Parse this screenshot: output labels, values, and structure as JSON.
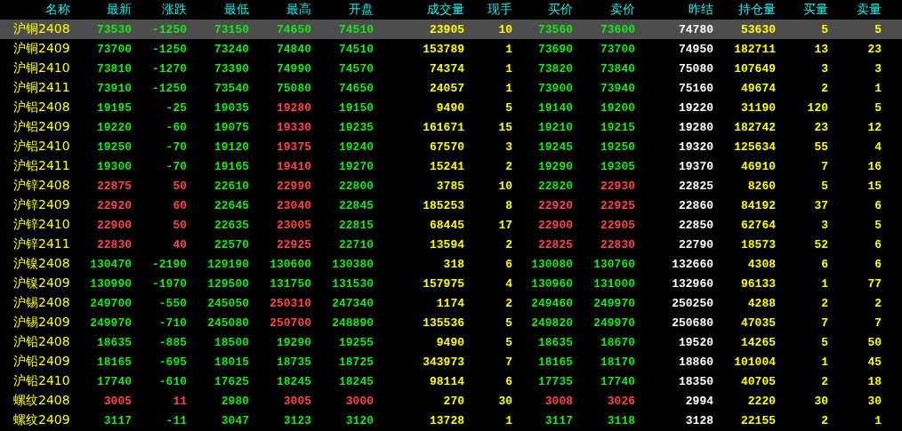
{
  "table": {
    "columns": [
      {
        "label": "名称",
        "kind": "name"
      },
      {
        "label": "最新",
        "kind": "price"
      },
      {
        "label": "涨跌",
        "kind": "price"
      },
      {
        "label": "最低",
        "kind": "price"
      },
      {
        "label": "最高",
        "kind": "price"
      },
      {
        "label": "开盘",
        "kind": "price"
      },
      {
        "label": "成交量",
        "kind": "volume"
      },
      {
        "label": "现手",
        "kind": "volume"
      },
      {
        "label": "买价",
        "kind": "price"
      },
      {
        "label": "卖价",
        "kind": "price"
      },
      {
        "label": "昨结",
        "kind": "settle"
      },
      {
        "label": "持仓量",
        "kind": "volume"
      },
      {
        "label": "买量",
        "kind": "volume"
      },
      {
        "label": "卖量",
        "kind": "volume"
      }
    ],
    "rows": [
      {
        "selected": true,
        "cells": [
          {
            "text": "沪铜2408"
          },
          {
            "text": "73530",
            "color": "#19e619"
          },
          {
            "text": "-1250",
            "color": "#19e619"
          },
          {
            "text": "73150",
            "color": "#19e619"
          },
          {
            "text": "74650",
            "color": "#19e619"
          },
          {
            "text": "74510",
            "color": "#19e619"
          },
          {
            "text": "23905"
          },
          {
            "text": "10"
          },
          {
            "text": "73560",
            "color": "#19e619"
          },
          {
            "text": "73600",
            "color": "#19e619"
          },
          {
            "text": "74780"
          },
          {
            "text": "53630"
          },
          {
            "text": "5"
          },
          {
            "text": "5"
          }
        ]
      },
      {
        "selected": false,
        "cells": [
          {
            "text": "沪铜2409"
          },
          {
            "text": "73700",
            "color": "#19e619"
          },
          {
            "text": "-1250",
            "color": "#19e619"
          },
          {
            "text": "73240",
            "color": "#19e619"
          },
          {
            "text": "74840",
            "color": "#19e619"
          },
          {
            "text": "74510",
            "color": "#19e619"
          },
          {
            "text": "153789"
          },
          {
            "text": "1"
          },
          {
            "text": "73690",
            "color": "#19e619"
          },
          {
            "text": "73700",
            "color": "#19e619"
          },
          {
            "text": "74950"
          },
          {
            "text": "182711"
          },
          {
            "text": "13"
          },
          {
            "text": "23"
          }
        ]
      },
      {
        "selected": false,
        "cells": [
          {
            "text": "沪铜2410"
          },
          {
            "text": "73810",
            "color": "#19e619"
          },
          {
            "text": "-1270",
            "color": "#19e619"
          },
          {
            "text": "73390",
            "color": "#19e619"
          },
          {
            "text": "74990",
            "color": "#19e619"
          },
          {
            "text": "74570",
            "color": "#19e619"
          },
          {
            "text": "74374"
          },
          {
            "text": "1"
          },
          {
            "text": "73820",
            "color": "#19e619"
          },
          {
            "text": "73840",
            "color": "#19e619"
          },
          {
            "text": "75080"
          },
          {
            "text": "107649"
          },
          {
            "text": "3"
          },
          {
            "text": "3"
          }
        ]
      },
      {
        "selected": false,
        "cells": [
          {
            "text": "沪铜2411"
          },
          {
            "text": "73910",
            "color": "#19e619"
          },
          {
            "text": "-1250",
            "color": "#19e619"
          },
          {
            "text": "73540",
            "color": "#19e619"
          },
          {
            "text": "75080",
            "color": "#19e619"
          },
          {
            "text": "74650",
            "color": "#19e619"
          },
          {
            "text": "24057"
          },
          {
            "text": "1"
          },
          {
            "text": "73900",
            "color": "#19e619"
          },
          {
            "text": "73940",
            "color": "#19e619"
          },
          {
            "text": "75160"
          },
          {
            "text": "49674"
          },
          {
            "text": "2"
          },
          {
            "text": "1"
          }
        ]
      },
      {
        "selected": false,
        "cells": [
          {
            "text": "沪铝2408"
          },
          {
            "text": "19195",
            "color": "#19e619"
          },
          {
            "text": "-25",
            "color": "#19e619"
          },
          {
            "text": "19035",
            "color": "#19e619"
          },
          {
            "text": "19280",
            "color": "#ff4646"
          },
          {
            "text": "19150",
            "color": "#19e619"
          },
          {
            "text": "9490"
          },
          {
            "text": "5"
          },
          {
            "text": "19140",
            "color": "#19e619"
          },
          {
            "text": "19200",
            "color": "#19e619"
          },
          {
            "text": "19220"
          },
          {
            "text": "31190"
          },
          {
            "text": "120"
          },
          {
            "text": "5"
          }
        ]
      },
      {
        "selected": false,
        "cells": [
          {
            "text": "沪铝2409"
          },
          {
            "text": "19220",
            "color": "#19e619"
          },
          {
            "text": "-60",
            "color": "#19e619"
          },
          {
            "text": "19075",
            "color": "#19e619"
          },
          {
            "text": "19330",
            "color": "#ff4646"
          },
          {
            "text": "19235",
            "color": "#19e619"
          },
          {
            "text": "161671"
          },
          {
            "text": "15"
          },
          {
            "text": "19210",
            "color": "#19e619"
          },
          {
            "text": "19215",
            "color": "#19e619"
          },
          {
            "text": "19280"
          },
          {
            "text": "182742"
          },
          {
            "text": "23"
          },
          {
            "text": "12"
          }
        ]
      },
      {
        "selected": false,
        "cells": [
          {
            "text": "沪铝2410"
          },
          {
            "text": "19250",
            "color": "#19e619"
          },
          {
            "text": "-70",
            "color": "#19e619"
          },
          {
            "text": "19120",
            "color": "#19e619"
          },
          {
            "text": "19375",
            "color": "#ff4646"
          },
          {
            "text": "19240",
            "color": "#19e619"
          },
          {
            "text": "67570"
          },
          {
            "text": "3"
          },
          {
            "text": "19245",
            "color": "#19e619"
          },
          {
            "text": "19250",
            "color": "#19e619"
          },
          {
            "text": "19320"
          },
          {
            "text": "125634"
          },
          {
            "text": "55"
          },
          {
            "text": "4"
          }
        ]
      },
      {
        "selected": false,
        "cells": [
          {
            "text": "沪铝2411"
          },
          {
            "text": "19300",
            "color": "#19e619"
          },
          {
            "text": "-70",
            "color": "#19e619"
          },
          {
            "text": "19165",
            "color": "#19e619"
          },
          {
            "text": "19410",
            "color": "#ff4646"
          },
          {
            "text": "19270",
            "color": "#19e619"
          },
          {
            "text": "15241"
          },
          {
            "text": "2"
          },
          {
            "text": "19290",
            "color": "#19e619"
          },
          {
            "text": "19305",
            "color": "#19e619"
          },
          {
            "text": "19370"
          },
          {
            "text": "46910"
          },
          {
            "text": "7"
          },
          {
            "text": "16"
          }
        ]
      },
      {
        "selected": false,
        "cells": [
          {
            "text": "沪锌2408"
          },
          {
            "text": "22875",
            "color": "#ff4646"
          },
          {
            "text": "50",
            "color": "#ff4646"
          },
          {
            "text": "22610",
            "color": "#19e619"
          },
          {
            "text": "22990",
            "color": "#ff4646"
          },
          {
            "text": "22800",
            "color": "#19e619"
          },
          {
            "text": "3785"
          },
          {
            "text": "10"
          },
          {
            "text": "22820",
            "color": "#19e619"
          },
          {
            "text": "22930",
            "color": "#ff4646"
          },
          {
            "text": "22825"
          },
          {
            "text": "8260"
          },
          {
            "text": "5"
          },
          {
            "text": "15"
          }
        ]
      },
      {
        "selected": false,
        "cells": [
          {
            "text": "沪锌2409"
          },
          {
            "text": "22920",
            "color": "#ff4646"
          },
          {
            "text": "60",
            "color": "#ff4646"
          },
          {
            "text": "22645",
            "color": "#19e619"
          },
          {
            "text": "23040",
            "color": "#ff4646"
          },
          {
            "text": "22845",
            "color": "#19e619"
          },
          {
            "text": "185253"
          },
          {
            "text": "8"
          },
          {
            "text": "22920",
            "color": "#ff4646"
          },
          {
            "text": "22925",
            "color": "#ff4646"
          },
          {
            "text": "22860"
          },
          {
            "text": "84192"
          },
          {
            "text": "37"
          },
          {
            "text": "6"
          }
        ]
      },
      {
        "selected": false,
        "cells": [
          {
            "text": "沪锌2410"
          },
          {
            "text": "22900",
            "color": "#ff4646"
          },
          {
            "text": "50",
            "color": "#ff4646"
          },
          {
            "text": "22635",
            "color": "#19e619"
          },
          {
            "text": "23005",
            "color": "#ff4646"
          },
          {
            "text": "22815",
            "color": "#19e619"
          },
          {
            "text": "68445"
          },
          {
            "text": "17"
          },
          {
            "text": "22900",
            "color": "#ff4646"
          },
          {
            "text": "22905",
            "color": "#ff4646"
          },
          {
            "text": "22850"
          },
          {
            "text": "62764"
          },
          {
            "text": "3"
          },
          {
            "text": "5"
          }
        ]
      },
      {
        "selected": false,
        "cells": [
          {
            "text": "沪锌2411"
          },
          {
            "text": "22830",
            "color": "#ff4646"
          },
          {
            "text": "40",
            "color": "#ff4646"
          },
          {
            "text": "22570",
            "color": "#19e619"
          },
          {
            "text": "22925",
            "color": "#ff4646"
          },
          {
            "text": "22710",
            "color": "#19e619"
          },
          {
            "text": "13594"
          },
          {
            "text": "2"
          },
          {
            "text": "22825",
            "color": "#ff4646"
          },
          {
            "text": "22830",
            "color": "#ff4646"
          },
          {
            "text": "22790"
          },
          {
            "text": "18573"
          },
          {
            "text": "52"
          },
          {
            "text": "6"
          }
        ]
      },
      {
        "selected": false,
        "cells": [
          {
            "text": "沪镍2408"
          },
          {
            "text": "130470",
            "color": "#19e619"
          },
          {
            "text": "-2190",
            "color": "#19e619"
          },
          {
            "text": "129190",
            "color": "#19e619"
          },
          {
            "text": "130600",
            "color": "#19e619"
          },
          {
            "text": "130380",
            "color": "#19e619"
          },
          {
            "text": "318"
          },
          {
            "text": "6"
          },
          {
            "text": "130080",
            "color": "#19e619"
          },
          {
            "text": "130760",
            "color": "#19e619"
          },
          {
            "text": "132660"
          },
          {
            "text": "4308"
          },
          {
            "text": "6"
          },
          {
            "text": "6"
          }
        ]
      },
      {
        "selected": false,
        "cells": [
          {
            "text": "沪镍2409"
          },
          {
            "text": "130990",
            "color": "#19e619"
          },
          {
            "text": "-1970",
            "color": "#19e619"
          },
          {
            "text": "129500",
            "color": "#19e619"
          },
          {
            "text": "131750",
            "color": "#19e619"
          },
          {
            "text": "131530",
            "color": "#19e619"
          },
          {
            "text": "157975"
          },
          {
            "text": "4"
          },
          {
            "text": "130960",
            "color": "#19e619"
          },
          {
            "text": "131000",
            "color": "#19e619"
          },
          {
            "text": "132960"
          },
          {
            "text": "96133"
          },
          {
            "text": "1"
          },
          {
            "text": "77"
          }
        ]
      },
      {
        "selected": false,
        "cells": [
          {
            "text": "沪锡2408"
          },
          {
            "text": "249700",
            "color": "#19e619"
          },
          {
            "text": "-550",
            "color": "#19e619"
          },
          {
            "text": "245050",
            "color": "#19e619"
          },
          {
            "text": "250310",
            "color": "#ff4646"
          },
          {
            "text": "247340",
            "color": "#19e619"
          },
          {
            "text": "1174"
          },
          {
            "text": "2"
          },
          {
            "text": "249460",
            "color": "#19e619"
          },
          {
            "text": "249970",
            "color": "#19e619"
          },
          {
            "text": "250250"
          },
          {
            "text": "4288"
          },
          {
            "text": "2"
          },
          {
            "text": "2"
          }
        ]
      },
      {
        "selected": false,
        "cells": [
          {
            "text": "沪锡2409"
          },
          {
            "text": "249970",
            "color": "#19e619"
          },
          {
            "text": "-710",
            "color": "#19e619"
          },
          {
            "text": "245080",
            "color": "#19e619"
          },
          {
            "text": "250700",
            "color": "#ff4646"
          },
          {
            "text": "248890",
            "color": "#19e619"
          },
          {
            "text": "135536"
          },
          {
            "text": "5"
          },
          {
            "text": "249820",
            "color": "#19e619"
          },
          {
            "text": "249970",
            "color": "#19e619"
          },
          {
            "text": "250680"
          },
          {
            "text": "47035"
          },
          {
            "text": "7"
          },
          {
            "text": "7"
          }
        ]
      },
      {
        "selected": false,
        "cells": [
          {
            "text": "沪铅2408"
          },
          {
            "text": "18635",
            "color": "#19e619"
          },
          {
            "text": "-885",
            "color": "#19e619"
          },
          {
            "text": "18500",
            "color": "#19e619"
          },
          {
            "text": "19290",
            "color": "#19e619"
          },
          {
            "text": "19255",
            "color": "#19e619"
          },
          {
            "text": "9490"
          },
          {
            "text": "5"
          },
          {
            "text": "18635",
            "color": "#19e619"
          },
          {
            "text": "18670",
            "color": "#19e619"
          },
          {
            "text": "19520"
          },
          {
            "text": "14265"
          },
          {
            "text": "5"
          },
          {
            "text": "50"
          }
        ]
      },
      {
        "selected": false,
        "cells": [
          {
            "text": "沪铅2409"
          },
          {
            "text": "18165",
            "color": "#19e619"
          },
          {
            "text": "-695",
            "color": "#19e619"
          },
          {
            "text": "18015",
            "color": "#19e619"
          },
          {
            "text": "18735",
            "color": "#19e619"
          },
          {
            "text": "18725",
            "color": "#19e619"
          },
          {
            "text": "343973"
          },
          {
            "text": "7"
          },
          {
            "text": "18165",
            "color": "#19e619"
          },
          {
            "text": "18170",
            "color": "#19e619"
          },
          {
            "text": "18860"
          },
          {
            "text": "101004"
          },
          {
            "text": "1"
          },
          {
            "text": "45"
          }
        ]
      },
      {
        "selected": false,
        "cells": [
          {
            "text": "沪铅2410"
          },
          {
            "text": "17740",
            "color": "#19e619"
          },
          {
            "text": "-610",
            "color": "#19e619"
          },
          {
            "text": "17625",
            "color": "#19e619"
          },
          {
            "text": "18245",
            "color": "#19e619"
          },
          {
            "text": "18245",
            "color": "#19e619"
          },
          {
            "text": "98114"
          },
          {
            "text": "6"
          },
          {
            "text": "17735",
            "color": "#19e619"
          },
          {
            "text": "17740",
            "color": "#19e619"
          },
          {
            "text": "18350"
          },
          {
            "text": "40705"
          },
          {
            "text": "2"
          },
          {
            "text": "18"
          }
        ]
      },
      {
        "selected": false,
        "cells": [
          {
            "text": "螺纹2408"
          },
          {
            "text": "3005",
            "color": "#ff4646"
          },
          {
            "text": "11",
            "color": "#ff4646"
          },
          {
            "text": "2980",
            "color": "#19e619"
          },
          {
            "text": "3005",
            "color": "#ff4646"
          },
          {
            "text": "3000",
            "color": "#ff4646"
          },
          {
            "text": "270"
          },
          {
            "text": "30"
          },
          {
            "text": "3008",
            "color": "#ff4646"
          },
          {
            "text": "3026",
            "color": "#ff4646"
          },
          {
            "text": "2994"
          },
          {
            "text": "2220"
          },
          {
            "text": "30"
          },
          {
            "text": "30"
          }
        ]
      },
      {
        "selected": false,
        "cells": [
          {
            "text": "螺纹2409"
          },
          {
            "text": "3117",
            "color": "#19e619"
          },
          {
            "text": "-11",
            "color": "#19e619"
          },
          {
            "text": "3047",
            "color": "#19e619"
          },
          {
            "text": "3123",
            "color": "#19e619"
          },
          {
            "text": "3120",
            "color": "#19e619"
          },
          {
            "text": "13728"
          },
          {
            "text": "1"
          },
          {
            "text": "3117",
            "color": "#19e619"
          },
          {
            "text": "3118",
            "color": "#19e619"
          },
          {
            "text": "3128"
          },
          {
            "text": "22155"
          },
          {
            "text": "2"
          },
          {
            "text": "1"
          }
        ]
      }
    ]
  }
}
